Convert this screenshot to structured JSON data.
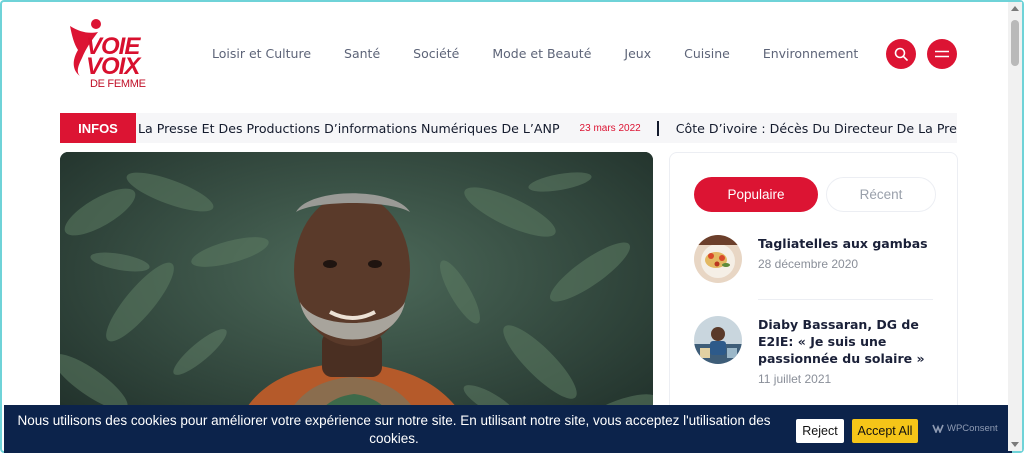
{
  "logo": {
    "line1": "VOIE",
    "line2": "VOIX",
    "line3": "DE FEMME",
    "brand_color": "#dc1433"
  },
  "nav": {
    "items": [
      {
        "label": "Loisir et Culture"
      },
      {
        "label": "Santé"
      },
      {
        "label": "Société"
      },
      {
        "label": "Mode et Beauté"
      },
      {
        "label": "Jeux"
      },
      {
        "label": "Cuisine"
      },
      {
        "label": "Environnement"
      }
    ],
    "search_icon": "search-icon",
    "menu_icon": "hamburger-menu-icon"
  },
  "ticker": {
    "label": "INFOS",
    "items": [
      {
        "text": "La Presse Et Des Productions D’informations Numériques De L’ANP",
        "date": "23 mars 2022"
      },
      {
        "text": "Côte D’ivoire : Décès Du Directeur De La Presse Et Des P",
        "date": ""
      }
    ]
  },
  "sidebar": {
    "tabs": [
      {
        "label": "Populaire",
        "active": true
      },
      {
        "label": "Récent",
        "active": false
      }
    ],
    "posts": [
      {
        "title": "Tagliatelles aux gambas",
        "date": "28 décembre 2020"
      },
      {
        "title": "Diaby Bassaran, DG de E2IE: « Je suis une passionnée du solaire »",
        "date": "11 juillet 2021"
      }
    ]
  },
  "cookie": {
    "message": "Nous utilisons des cookies pour améliorer votre expérience sur notre site. En utilisant notre site, vous acceptez l'utilisation des cookies.",
    "reject_label": "Reject",
    "accept_label": "Accept All",
    "brand": "WPConsent"
  },
  "colors": {
    "accent": "#dc1433",
    "cookie_bg": "#0c234b",
    "accept_bg": "#f5c518"
  }
}
